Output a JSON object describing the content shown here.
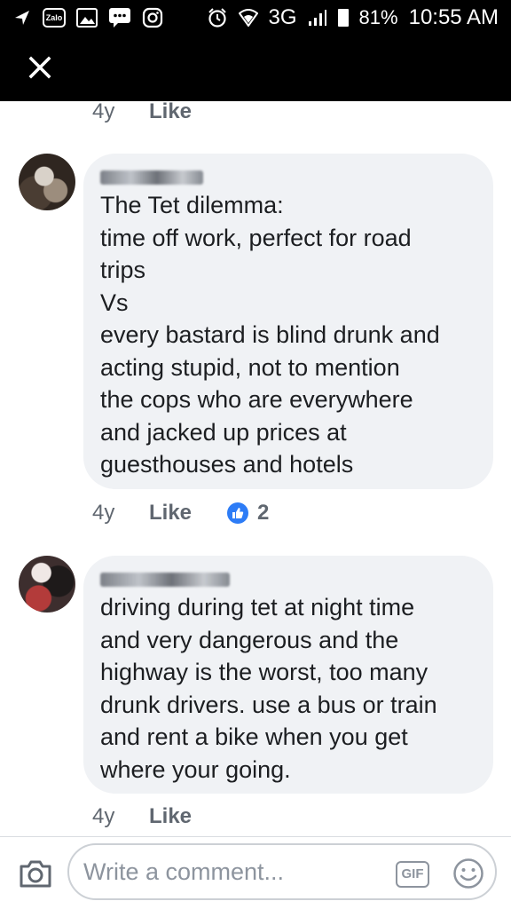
{
  "status_bar": {
    "zalo_label": "Zalo",
    "network": "3G",
    "battery": "81%",
    "time": "10:55 AM"
  },
  "header": {
    "close_icon": "close-icon"
  },
  "top_meta": {
    "time": "4y",
    "like": "Like"
  },
  "comments": [
    {
      "author_blurred": true,
      "lines": [
        "The Tet dilemma:",
        "time off work, perfect for road",
        "trips",
        "Vs",
        "every bastard is blind drunk and",
        "acting stupid,  not to mention",
        "the cops who are everywhere",
        "and jacked up prices at",
        "guesthouses and hotels"
      ],
      "time": "4y",
      "like": "Like",
      "reaction_count": "2"
    },
    {
      "author_blurred": true,
      "lines": [
        "driving during tet at night time",
        "and very dangerous and the",
        "highway is the worst, too many",
        "drunk drivers. use a bus or train",
        "and rent a bike when you get",
        "where your going."
      ],
      "time": "4y",
      "like": "Like"
    }
  ],
  "composer": {
    "placeholder": "Write a comment...",
    "gif_label": "GIF"
  },
  "colors": {
    "bubble": "#f0f2f5",
    "like_blue": "#2d7cf6",
    "meta_gray": "#606770"
  }
}
